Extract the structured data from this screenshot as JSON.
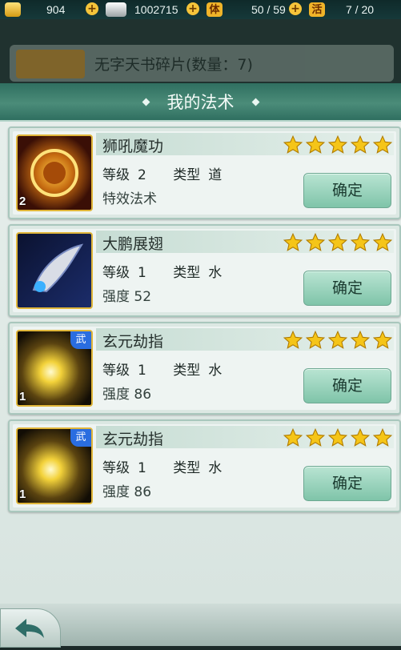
{
  "topbar": {
    "gold": "904",
    "silver": "1002715",
    "stamina_label": "体",
    "stamina": "50 / 59",
    "activity_label": "活",
    "activity": "7 / 20"
  },
  "background_item": {
    "label": "无字天书碎片(数量：7)"
  },
  "dialog": {
    "title": "我的法术"
  },
  "spells": [
    {
      "name": "狮吼魔功",
      "level_label": "等级",
      "level": "2",
      "type_label": "类型",
      "type": "道",
      "detail": "特效法术",
      "stars": 5,
      "button": "确定",
      "icon_level": "2",
      "badge": ""
    },
    {
      "name": "大鹏展翅",
      "level_label": "等级",
      "level": "1",
      "type_label": "类型",
      "type": "水",
      "detail": "强度 52",
      "stars": 5,
      "button": "确定",
      "icon_level": "",
      "badge": ""
    },
    {
      "name": "玄元劫指",
      "level_label": "等级",
      "level": "1",
      "type_label": "类型",
      "type": "水",
      "detail": "强度 86",
      "stars": 5,
      "button": "确定",
      "icon_level": "1",
      "badge": "武"
    },
    {
      "name": "玄元劫指",
      "level_label": "等级",
      "level": "1",
      "type_label": "类型",
      "type": "水",
      "detail": "强度 86",
      "stars": 5,
      "button": "确定",
      "icon_level": "1",
      "badge": "武"
    }
  ],
  "icons": {
    "gold": "gold-ingot-icon",
    "silver": "silver-ingot-icon",
    "add": "plus-icon",
    "back": "back-arrow-icon",
    "star": "star-icon"
  },
  "colors": {
    "header": "#3d7f6c",
    "button": "#9fd5be",
    "star": "#f5c518"
  }
}
